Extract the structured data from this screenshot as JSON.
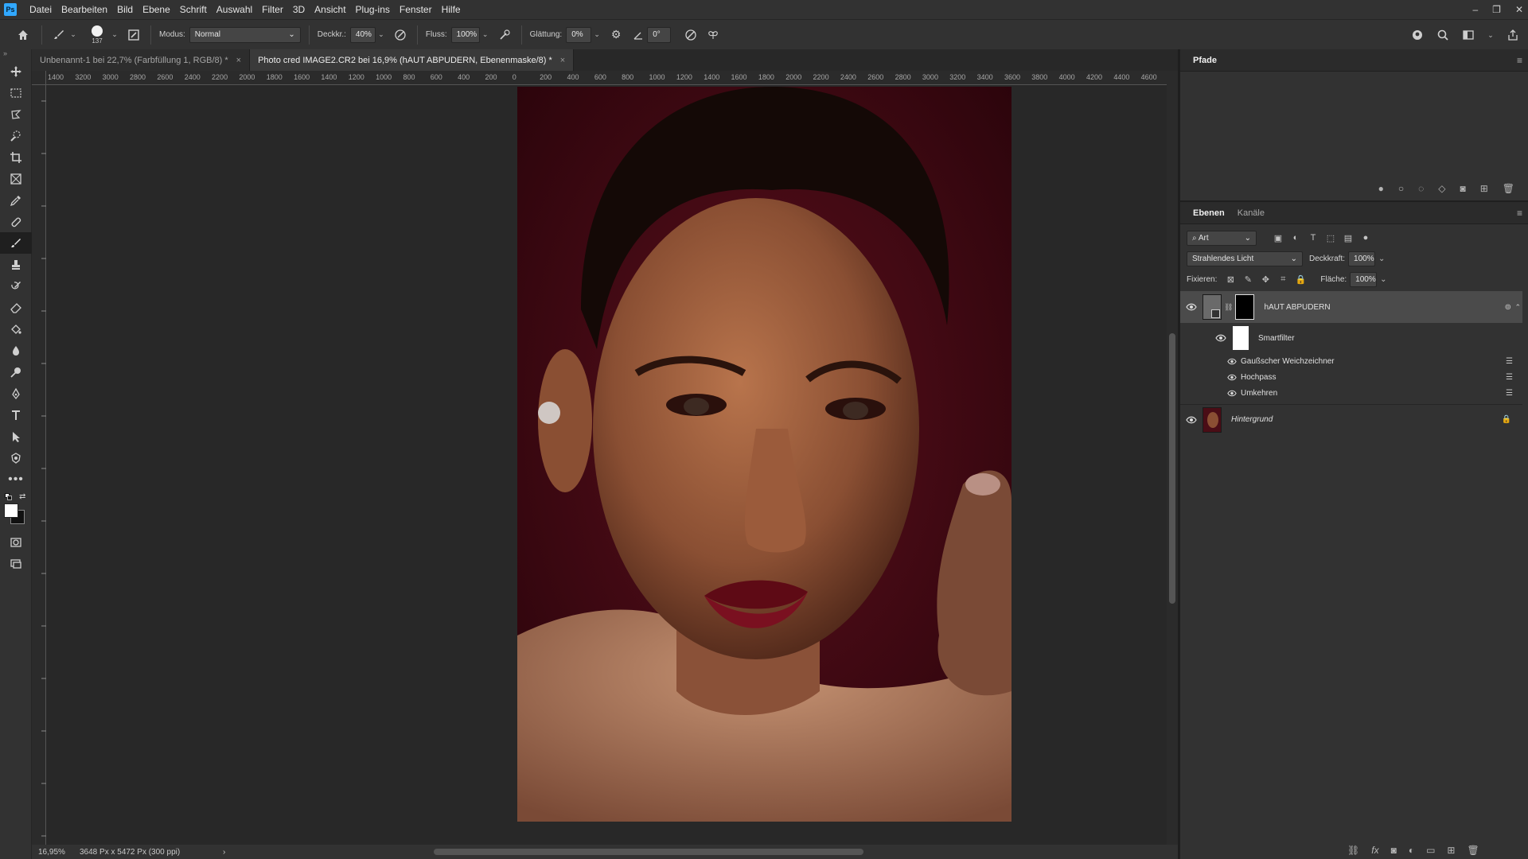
{
  "app": {
    "logo": "Ps"
  },
  "menu": [
    "Datei",
    "Bearbeiten",
    "Bild",
    "Ebene",
    "Schrift",
    "Auswahl",
    "Filter",
    "3D",
    "Ansicht",
    "Plug-ins",
    "Fenster",
    "Hilfe"
  ],
  "window_controls": {
    "minimize": "–",
    "restore": "❐",
    "close": "✕"
  },
  "options": {
    "brush_size": "137",
    "modus_label": "Modus:",
    "modus_value": "Normal",
    "deckkraft_label": "Deckkr.:",
    "deckkraft_value": "40%",
    "fluss_label": "Fluss:",
    "fluss_value": "100%",
    "glaettung_label": "Glättung:",
    "glaettung_value": "0%",
    "angle_value": "0°"
  },
  "tabs": [
    {
      "label": "Unbenannt-1 bei 22,7% (Farbfüllung 1, RGB/8) *",
      "close": "×"
    },
    {
      "label": "Photo cred IMAGE2.CR2 bei 16,9% (hAUT ABPUDERN, Ebenenmaske/8) *",
      "close": "×"
    }
  ],
  "ruler_h": [
    "1400",
    "3200",
    "3000",
    "2800",
    "2600",
    "2400",
    "2200",
    "2000",
    "1800",
    "1600",
    "1400",
    "1200",
    "1000",
    "800",
    "600",
    "400",
    "200",
    "0",
    "200",
    "400",
    "600",
    "800",
    "1000",
    "1200",
    "1400",
    "1600",
    "1800",
    "2000",
    "2200",
    "2400",
    "2600",
    "2800",
    "3000",
    "3200",
    "3400",
    "3600",
    "3800",
    "4000",
    "4200",
    "4400",
    "4600"
  ],
  "status": {
    "zoom": "16,95%",
    "dimensions": "3648 Px x 5472 Px (300 ppi)",
    "arrow": "›"
  },
  "panels": {
    "pfade_title": "Pfade",
    "ebenen_tab": "Ebenen",
    "kanaele_tab": "Kanäle",
    "search_label": "Art",
    "blend_mode": "Strahlendes Licht",
    "deckkraft_label": "Deckkraft:",
    "deckkraft_value": "100%",
    "fixieren_label": "Fixieren:",
    "flaeche_label": "Fläche:",
    "flaeche_value": "100%"
  },
  "layers": [
    {
      "name": "hAUT ABPUDERN"
    },
    {
      "name": "Smartfilter"
    },
    {
      "name": "Gaußscher Weichzeichner"
    },
    {
      "name": "Hochpass"
    },
    {
      "name": "Umkehren"
    },
    {
      "name": "Hintergrund"
    }
  ],
  "colors": {
    "accent": "#31a8ff",
    "canvas_bg": "#282828",
    "photo_bg": "#3a0812"
  }
}
